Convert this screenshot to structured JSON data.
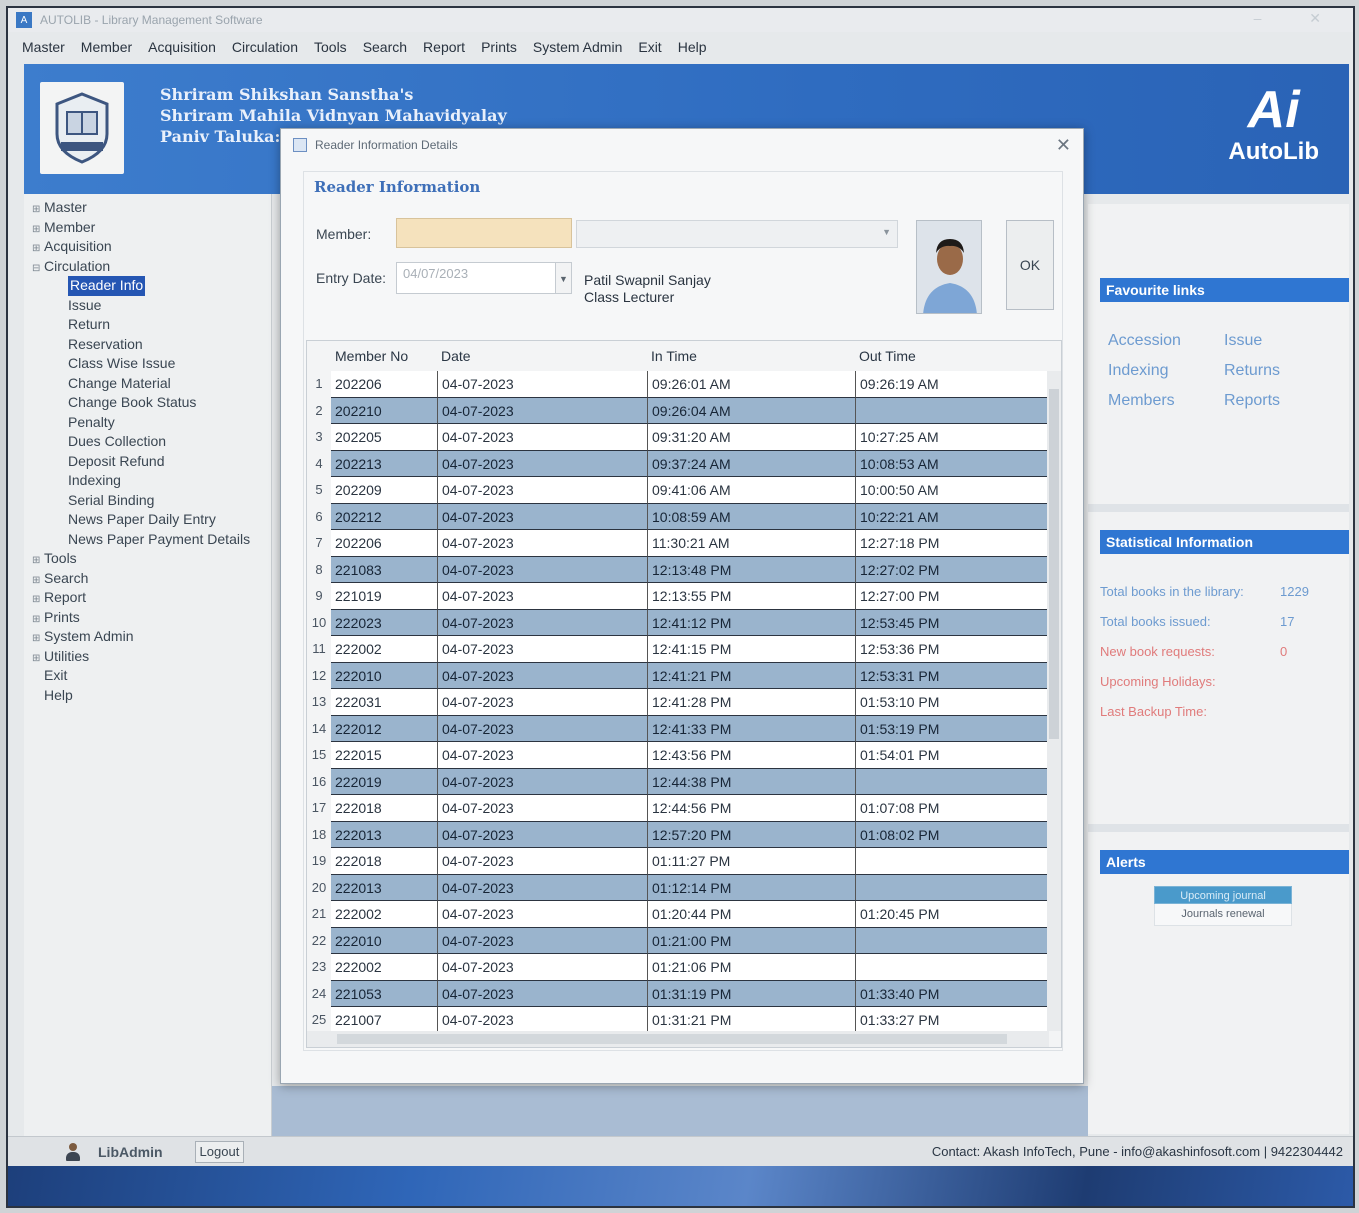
{
  "window": {
    "title": "AUTOLIB - Library Management Software"
  },
  "menu": [
    "Master",
    "Member",
    "Acquisition",
    "Circulation",
    "Tools",
    "Search",
    "Report",
    "Prints",
    "System Admin",
    "Exit",
    "Help"
  ],
  "banner": {
    "line1": "Shriram Shikshan Sanstha's",
    "line2": "Shriram Mahila Vidnyan Mahavidyalay",
    "line3": "Paniv Taluka: M",
    "brand": "AutoLib",
    "brand_mark": "Ai"
  },
  "sidebar": {
    "items": [
      {
        "label": "Master",
        "type": "collapsed"
      },
      {
        "label": "Member",
        "type": "collapsed"
      },
      {
        "label": "Acquisition",
        "type": "collapsed"
      },
      {
        "label": "Circulation",
        "type": "expanded"
      },
      {
        "label": "Reader Info",
        "type": "child",
        "selected": true
      },
      {
        "label": "Issue",
        "type": "child"
      },
      {
        "label": "Return",
        "type": "child"
      },
      {
        "label": "Reservation",
        "type": "child"
      },
      {
        "label": "Class Wise Issue",
        "type": "child"
      },
      {
        "label": "Change Material",
        "type": "child"
      },
      {
        "label": "Change Book Status",
        "type": "child"
      },
      {
        "label": "Penalty",
        "type": "child"
      },
      {
        "label": "Dues Collection",
        "type": "child"
      },
      {
        "label": "Deposit Refund",
        "type": "child"
      },
      {
        "label": "Indexing",
        "type": "child"
      },
      {
        "label": "Serial Binding",
        "type": "child"
      },
      {
        "label": "News Paper Daily Entry",
        "type": "child"
      },
      {
        "label": "News Paper Payment Details",
        "type": "child"
      },
      {
        "label": "Tools",
        "type": "collapsed"
      },
      {
        "label": "Search",
        "type": "collapsed"
      },
      {
        "label": "Report",
        "type": "collapsed"
      },
      {
        "label": "Prints",
        "type": "collapsed"
      },
      {
        "label": "System Admin",
        "type": "collapsed"
      },
      {
        "label": "Utilities",
        "type": "collapsed"
      },
      {
        "label": "Exit",
        "type": "plain"
      },
      {
        "label": "Help",
        "type": "plain"
      }
    ]
  },
  "dialog": {
    "title": "Reader Information Details",
    "group_title": "Reader Information",
    "member_label": "Member:",
    "member_value": "",
    "entry_date_label": "Entry Date:",
    "entry_date_value": "04/07/2023",
    "reader_name": "Patil Swapnil Sanjay",
    "reader_designation": "Class Lecturer",
    "ok_label": "OK",
    "columns": [
      "Member No",
      "Date",
      "In Time",
      "Out Time"
    ],
    "rows": [
      {
        "n": "1",
        "member": "202206",
        "date": "04-07-2023",
        "in": "09:26:01 AM",
        "out": "09:26:19 AM"
      },
      {
        "n": "2",
        "member": "202210",
        "date": "04-07-2023",
        "in": "09:26:04 AM",
        "out": ""
      },
      {
        "n": "3",
        "member": "202205",
        "date": "04-07-2023",
        "in": "09:31:20 AM",
        "out": "10:27:25 AM"
      },
      {
        "n": "4",
        "member": "202213",
        "date": "04-07-2023",
        "in": "09:37:24 AM",
        "out": "10:08:53 AM"
      },
      {
        "n": "5",
        "member": "202209",
        "date": "04-07-2023",
        "in": "09:41:06 AM",
        "out": "10:00:50 AM"
      },
      {
        "n": "6",
        "member": "202212",
        "date": "04-07-2023",
        "in": "10:08:59 AM",
        "out": "10:22:21 AM"
      },
      {
        "n": "7",
        "member": "202206",
        "date": "04-07-2023",
        "in": "11:30:21 AM",
        "out": "12:27:18 PM"
      },
      {
        "n": "8",
        "member": "221083",
        "date": "04-07-2023",
        "in": "12:13:48 PM",
        "out": "12:27:02 PM"
      },
      {
        "n": "9",
        "member": "221019",
        "date": "04-07-2023",
        "in": "12:13:55 PM",
        "out": "12:27:00 PM"
      },
      {
        "n": "10",
        "member": "222023",
        "date": "04-07-2023",
        "in": "12:41:12 PM",
        "out": "12:53:45 PM"
      },
      {
        "n": "11",
        "member": "222002",
        "date": "04-07-2023",
        "in": "12:41:15 PM",
        "out": "12:53:36 PM"
      },
      {
        "n": "12",
        "member": "222010",
        "date": "04-07-2023",
        "in": "12:41:21 PM",
        "out": "12:53:31 PM"
      },
      {
        "n": "13",
        "member": "222031",
        "date": "04-07-2023",
        "in": "12:41:28 PM",
        "out": "01:53:10 PM"
      },
      {
        "n": "14",
        "member": "222012",
        "date": "04-07-2023",
        "in": "12:41:33 PM",
        "out": "01:53:19 PM"
      },
      {
        "n": "15",
        "member": "222015",
        "date": "04-07-2023",
        "in": "12:43:56 PM",
        "out": "01:54:01 PM"
      },
      {
        "n": "16",
        "member": "222019",
        "date": "04-07-2023",
        "in": "12:44:38 PM",
        "out": ""
      },
      {
        "n": "17",
        "member": "222018",
        "date": "04-07-2023",
        "in": "12:44:56 PM",
        "out": "01:07:08 PM"
      },
      {
        "n": "18",
        "member": "222013",
        "date": "04-07-2023",
        "in": "12:57:20 PM",
        "out": "01:08:02 PM"
      },
      {
        "n": "19",
        "member": "222018",
        "date": "04-07-2023",
        "in": "01:11:27 PM",
        "out": ""
      },
      {
        "n": "20",
        "member": "222013",
        "date": "04-07-2023",
        "in": "01:12:14 PM",
        "out": ""
      },
      {
        "n": "21",
        "member": "222002",
        "date": "04-07-2023",
        "in": "01:20:44 PM",
        "out": "01:20:45 PM"
      },
      {
        "n": "22",
        "member": "222010",
        "date": "04-07-2023",
        "in": "01:21:00 PM",
        "out": ""
      },
      {
        "n": "23",
        "member": "222002",
        "date": "04-07-2023",
        "in": "01:21:06 PM",
        "out": ""
      },
      {
        "n": "24",
        "member": "221053",
        "date": "04-07-2023",
        "in": "01:31:19 PM",
        "out": "01:33:40 PM"
      },
      {
        "n": "25",
        "member": "221007",
        "date": "04-07-2023",
        "in": "01:31:21 PM",
        "out": "01:33:27 PM"
      }
    ]
  },
  "right_panel": {
    "favourite_title": "Favourite links",
    "favourites": [
      "Accession",
      "Issue",
      "Indexing",
      "Returns",
      "Members",
      "Reports"
    ],
    "stats_title": "Statistical Information",
    "stats": [
      {
        "label": "Total books in the library:",
        "value": "1229",
        "color": "#6d9bd0"
      },
      {
        "label": "Total books issued:",
        "value": "17",
        "color": "#6d9bd0"
      },
      {
        "label": "New book requests:",
        "value": "0",
        "color": "#e07b7b"
      },
      {
        "label": "Upcoming Holidays:",
        "value": "",
        "color": "#e07b7b"
      },
      {
        "label": "Last Backup Time:",
        "value": "",
        "color": "#e07b7b"
      }
    ],
    "alerts_title": "Alerts",
    "alert_tab": "Upcoming journal",
    "alert_body": "Journals renewal"
  },
  "status": {
    "user": "LibAdmin",
    "logout_label": "Logout",
    "contact": "Contact: Akash InfoTech, Pune - info@akashinfosoft.com | 9422304442"
  }
}
